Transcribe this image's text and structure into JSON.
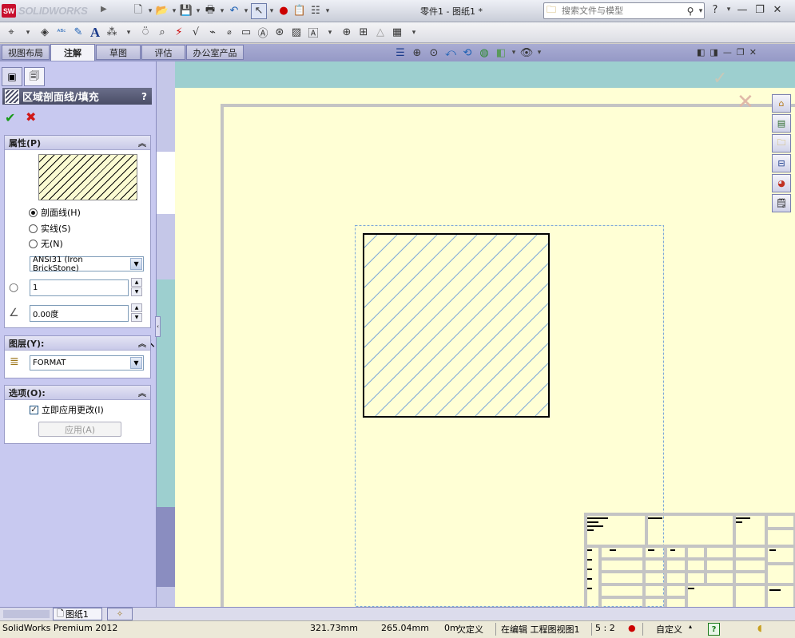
{
  "app": {
    "logo_text": "SOLIDWORKS",
    "logo_mark": "SW"
  },
  "title_bar": {
    "document_title": "零件1 - 图纸1 *"
  },
  "search": {
    "placeholder": "搜索文件与模型"
  },
  "window_controls": {
    "help": "?"
  },
  "tabs": [
    {
      "label": "视图布局"
    },
    {
      "label": "注解"
    },
    {
      "label": "草图"
    },
    {
      "label": "评估"
    },
    {
      "label": "办公室产品"
    }
  ],
  "property_manager": {
    "title": "区域剖面线/填充",
    "help": "?",
    "ok": "✔",
    "cancel": "✖",
    "properties_group": {
      "title": "属性(P)",
      "radios": [
        {
          "label": "剖面线(H)",
          "checked": true
        },
        {
          "label": "实线(S)",
          "checked": false
        },
        {
          "label": "无(N)",
          "checked": false
        }
      ],
      "pattern": "ANSI31 (Iron BrickStone)",
      "scale": "1",
      "angle": "0.00度"
    },
    "layer_group": {
      "title": "图层(Y):",
      "layer": "FORMAT"
    },
    "options_group": {
      "title": "选项(O):",
      "apply_immediately": "立即应用更改(I)",
      "apply_immediately_checked": true,
      "apply_button": "应用(A)"
    }
  },
  "sheet_tabs": {
    "sheet1": "图纸1"
  },
  "status_bar": {
    "product": "SolidWorks Premium 2012",
    "x": "321.73mm",
    "y": "265.04mm",
    "z": "0m",
    "definition": "欠定义",
    "editing": "在编辑 工程图视图1",
    "scale": "5 : 2",
    "units": "自定义",
    "help": "?"
  },
  "colors": {
    "sheet": "#ffffd5",
    "graphics_bg": "#9dcfcf",
    "panel": "#c8c9f0",
    "hatch": "#7ba7d9"
  }
}
